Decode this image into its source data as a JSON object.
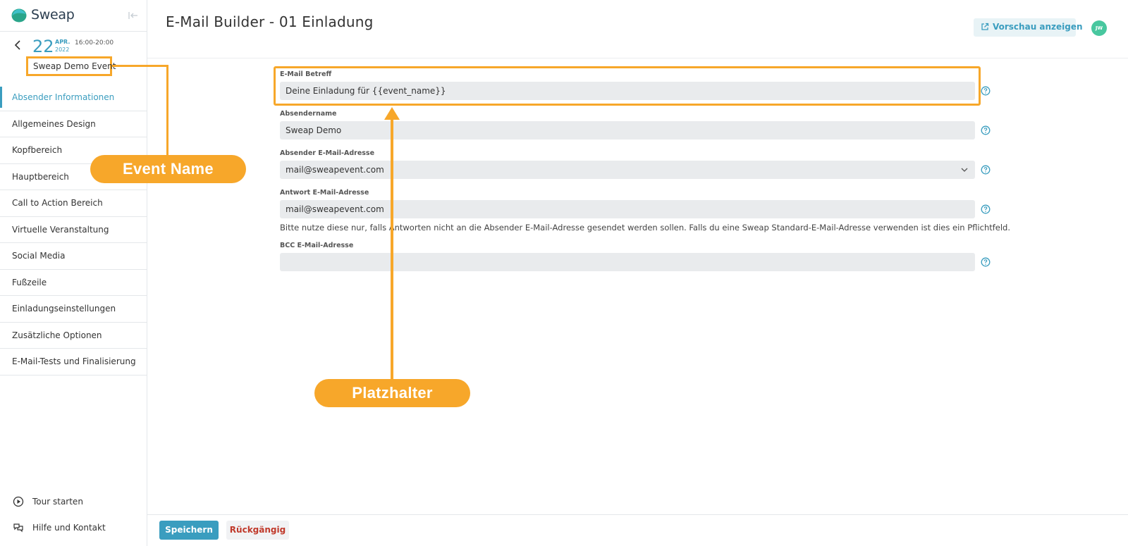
{
  "brand": {
    "name": "Sweap"
  },
  "event": {
    "day": "22",
    "month": "APR.",
    "year": "2022",
    "time": "16:00-20:00",
    "name": "Sweap Demo Event"
  },
  "sidebar": {
    "items": [
      {
        "label": "Absender Informationen",
        "active": true
      },
      {
        "label": "Allgemeines Design"
      },
      {
        "label": "Kopfbereich"
      },
      {
        "label": "Hauptbereich"
      },
      {
        "label": "Call to Action Bereich"
      },
      {
        "label": "Virtuelle Veranstaltung"
      },
      {
        "label": "Social Media"
      },
      {
        "label": "Fußzeile"
      },
      {
        "label": "Einladungseinstellungen"
      },
      {
        "label": "Zusätzliche Optionen"
      },
      {
        "label": "E-Mail-Tests und Finalisierung"
      }
    ],
    "bottom": {
      "tour": "Tour starten",
      "help": "Hilfe und Kontakt"
    }
  },
  "header": {
    "title": "E-Mail Builder - 01 Einladung",
    "preview_label": "Vorschau anzeigen",
    "avatar_initials": "JW"
  },
  "form": {
    "subject": {
      "label": "E-Mail Betreff",
      "value": "Deine Einladung für {{event_name}}"
    },
    "sender_name": {
      "label": "Absendername",
      "value": "Sweap Demo"
    },
    "sender_email": {
      "label": "Absender E-Mail-Adresse",
      "value": "mail@sweapevent.com"
    },
    "reply_email": {
      "label": "Antwort E-Mail-Adresse",
      "value": "mail@sweapevent.com",
      "hint": "Bitte nutze diese nur, falls Antworten nicht an die Absender E-Mail-Adresse gesendet werden sollen. Falls du eine Sweap Standard-E-Mail-Adresse verwenden ist dies ein Pflichtfeld."
    },
    "bcc_email": {
      "label": "BCC E-Mail-Adresse",
      "value": ""
    }
  },
  "annotations": {
    "event_name": "Event Name",
    "placeholder": "Platzhalter"
  },
  "footer": {
    "save_label": "Speichern",
    "undo_label": "Rückgängig"
  },
  "colors": {
    "accent": "#3a9dbf",
    "annotation": "#f7a72a",
    "avatar": "#48c79f",
    "danger": "#c0392b"
  }
}
